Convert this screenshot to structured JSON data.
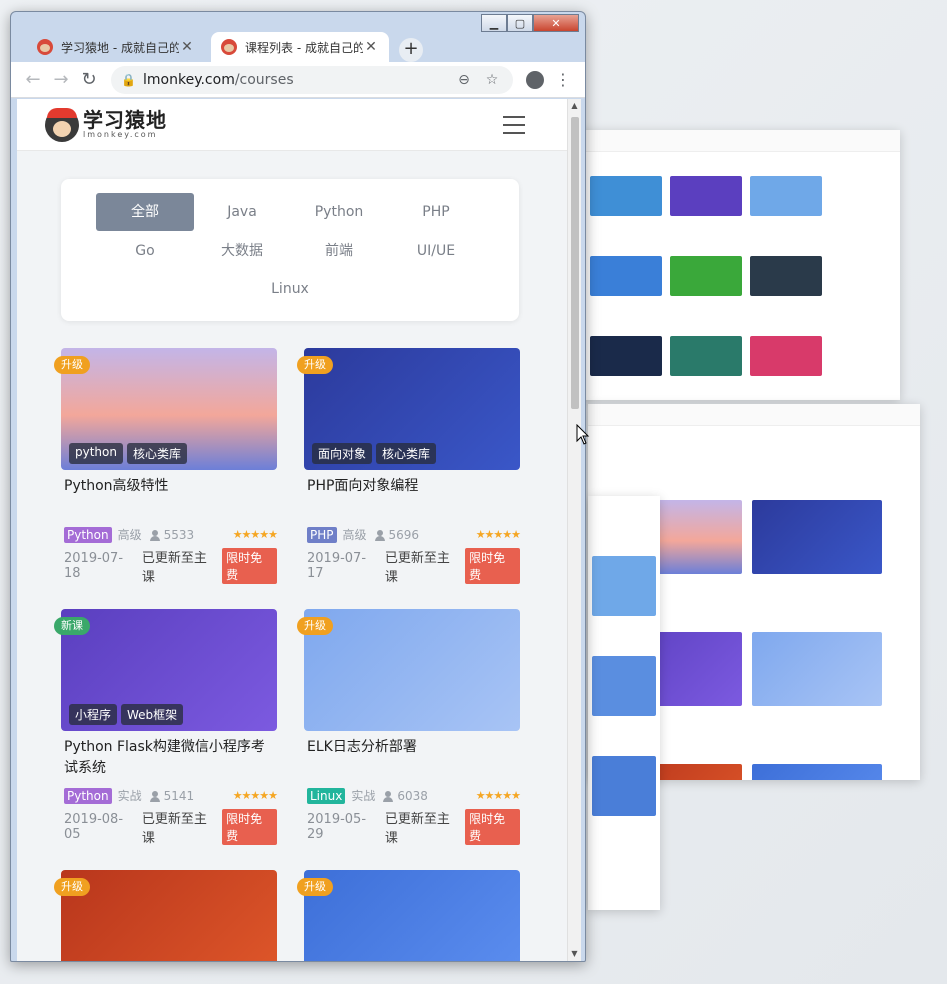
{
  "browser": {
    "tabs": [
      {
        "title": "学习猿地 - 成就自己的",
        "active": false
      },
      {
        "title": "课程列表 - 成就自己的",
        "active": true
      }
    ],
    "url_host": "lmonkey.com",
    "url_path": "/courses"
  },
  "site": {
    "logo_cn": "学习猿地",
    "logo_en": "lmonkey.com"
  },
  "filters": [
    "全部",
    "Java",
    "Python",
    "PHP",
    "Go",
    "大数据",
    "前端",
    "UI/UE",
    "Linux"
  ],
  "active_filter": "全部",
  "courses": [
    {
      "badge": "升级",
      "tags": [
        "python",
        "核心类库"
      ],
      "title": "Python高级特性",
      "lang": "Python",
      "lang_color": "#a46cd6",
      "level": "高级",
      "students": "5533",
      "stars": 5,
      "date": "2019-07-18",
      "update": "已更新至主课",
      "free": "限时免费"
    },
    {
      "badge": "升级",
      "tags": [
        "面向对象",
        "核心类库"
      ],
      "title": "PHP面向对象编程",
      "lang": "PHP",
      "lang_color": "#6f7fc8",
      "level": "高级",
      "students": "5696",
      "stars": 5,
      "date": "2019-07-17",
      "update": "已更新至主课",
      "free": "限时免费"
    },
    {
      "badge": "新课",
      "tags": [
        "小程序",
        "Web框架"
      ],
      "title": "Python Flask构建微信小程序考试系统",
      "lang": "Python",
      "lang_color": "#a46cd6",
      "level": "实战",
      "students": "5141",
      "stars": 5,
      "date": "2019-08-05",
      "update": "已更新至主课",
      "free": "限时免费"
    },
    {
      "badge": "升级",
      "tags": [],
      "title": "ELK日志分析部署",
      "lang": "Linux",
      "lang_color": "#22b59c",
      "level": "实战",
      "students": "6038",
      "stars": 5,
      "date": "2019-05-29",
      "update": "已更新至主课",
      "free": "限时免费"
    },
    {
      "badge": "升级",
      "tags": [],
      "title": "",
      "lang": "",
      "level": "",
      "students": "",
      "date": "",
      "update": "",
      "free": ""
    },
    {
      "badge": "升级",
      "tags": [],
      "title": "",
      "lang": "",
      "level": "",
      "students": "",
      "date": "",
      "update": "",
      "free": ""
    }
  ],
  "colors": {
    "accent": "#7b8799",
    "free_badge": "#e8604f",
    "upgrade_badge": "#f0a020",
    "new_badge": "#3aa86a",
    "stars": "#f5a623"
  },
  "icons": [
    "back-icon",
    "forward-icon",
    "reload-icon",
    "lock-icon",
    "zoom-icon",
    "star-icon",
    "account-icon",
    "more-icon",
    "menu-icon",
    "user-icon",
    "new-tab-icon"
  ]
}
